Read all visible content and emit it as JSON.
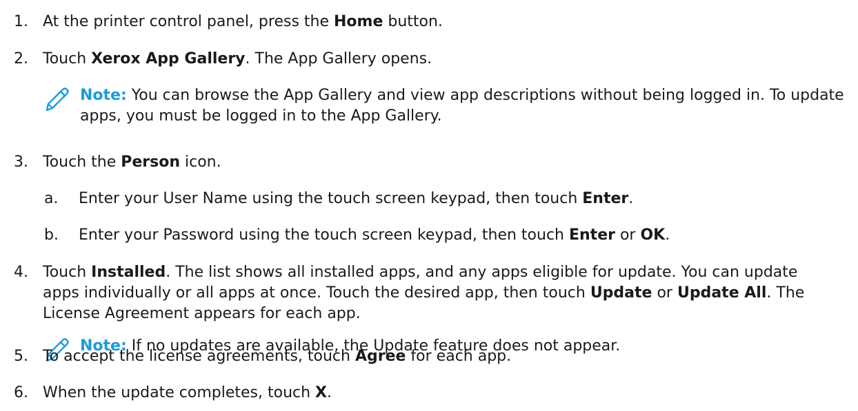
{
  "steps": [
    {
      "number": "1.",
      "before": "At the printer control panel, press the ",
      "bold": "Home",
      "after": " button."
    },
    {
      "number": "2.",
      "before": "Touch ",
      "bold": "Xerox App Gallery",
      "after": ". The App Gallery opens."
    },
    {
      "number": "3.",
      "before": "Touch the ",
      "bold": "Person",
      "after": " icon."
    },
    {
      "number": "4.",
      "p1": "Touch ",
      "b1": "Installed",
      "p2": ". The list shows all installed apps, and any apps eligible for update. You can update apps individually or all apps at once. Touch the desired app, then touch ",
      "b2": "Update",
      "p3": " or ",
      "b3": "Update All",
      "p4": ". The License Agreement appears for each app."
    },
    {
      "number": "5.",
      "before": "To accept the license agreements, touch ",
      "bold": "Agree",
      "after": " for each app."
    },
    {
      "number": "6.",
      "before": "When the update completes, touch ",
      "bold": "X",
      "after": "."
    }
  ],
  "substeps": [
    {
      "letter": "a.",
      "before": "Enter your User Name using the touch screen keypad, then touch ",
      "bold": "Enter",
      "after": "."
    },
    {
      "letter": "b.",
      "before": "Enter your Password using the touch screen keypad, then touch ",
      "b1": "Enter",
      "mid": " or ",
      "b2": "OK",
      "after": "."
    }
  ],
  "notes": [
    {
      "label": "Note:",
      "text": " You can browse the App Gallery and view app descriptions without being logged in. To update apps, you must be logged in to the App Gallery."
    },
    {
      "label": "Note:",
      "text": " If no updates are available, the Update feature does not appear."
    }
  ],
  "colors": {
    "note_accent": "#1e9ad6",
    "text": "#1a1a1a"
  },
  "icons": {
    "note": "pencil-icon"
  }
}
